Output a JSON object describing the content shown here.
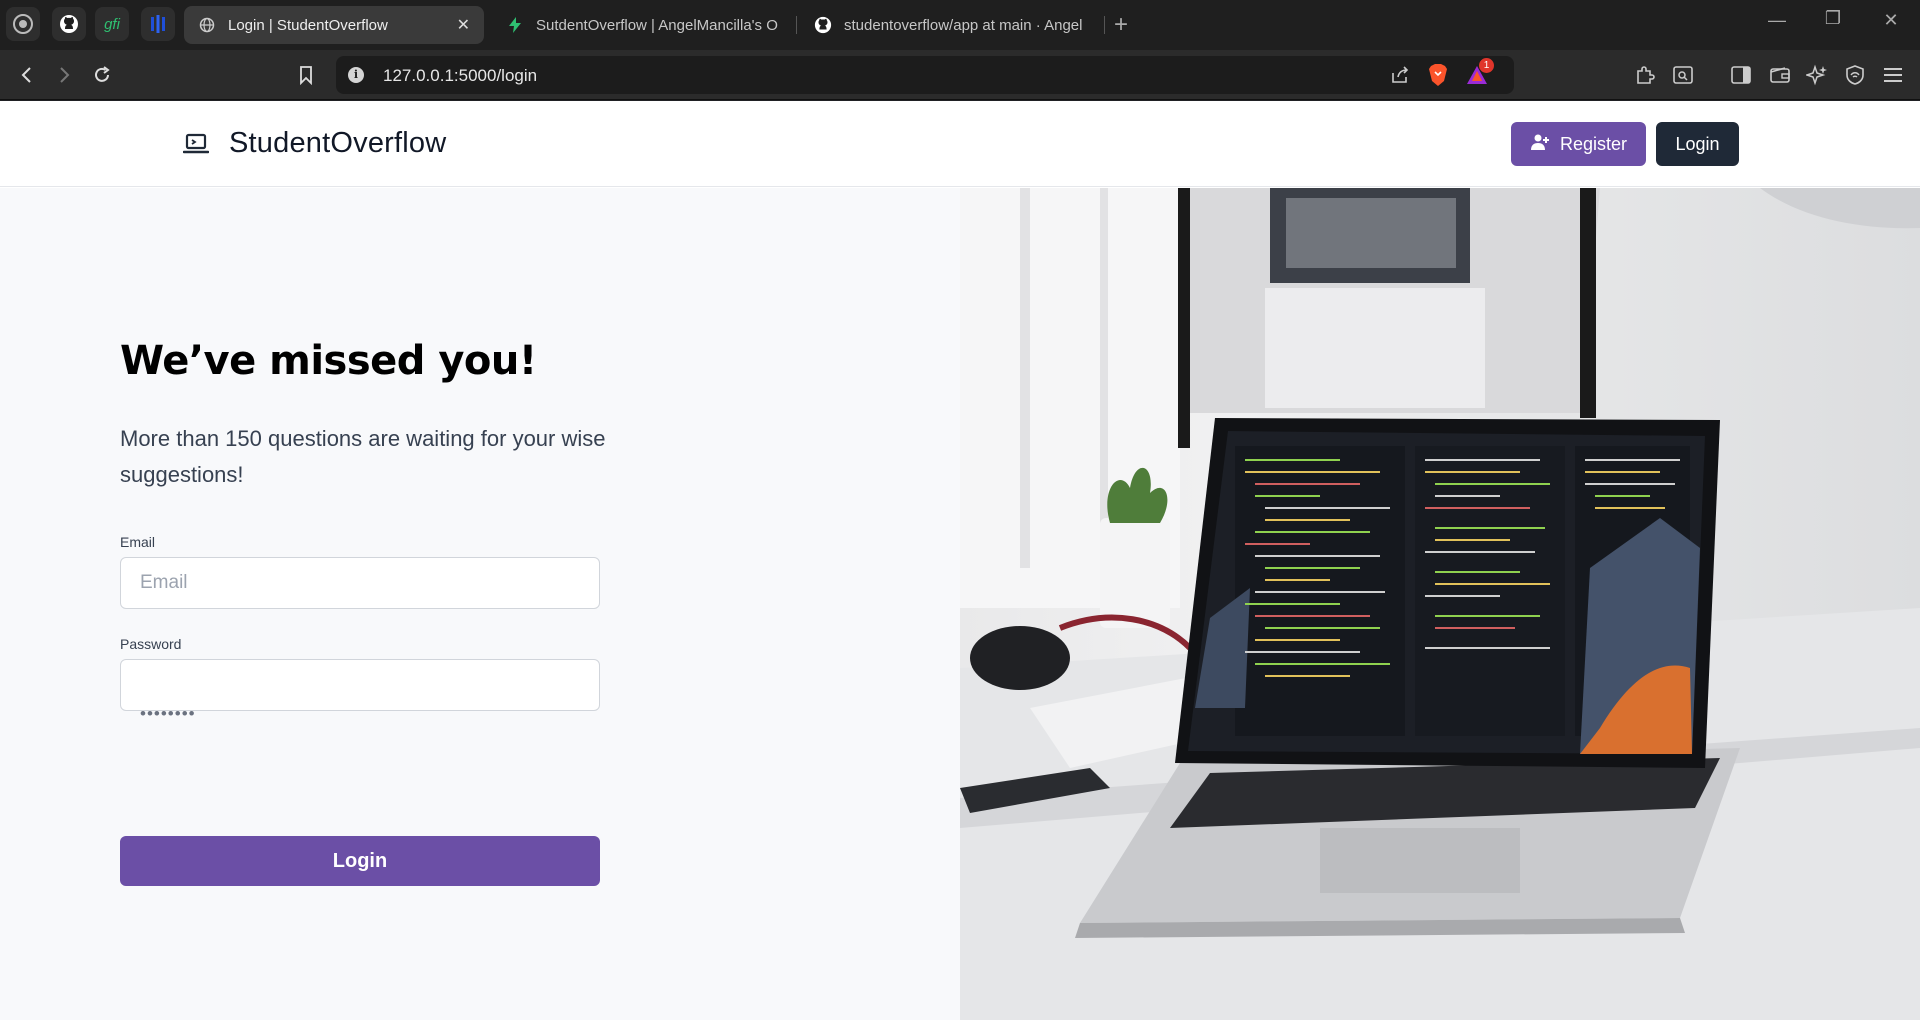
{
  "browser": {
    "pinned_tabs": [
      {
        "icon": "brave-rewards-icon"
      },
      {
        "icon": "github-icon"
      },
      {
        "icon": "gfi-icon",
        "label": "gfi"
      },
      {
        "icon": "app-icon"
      }
    ],
    "tabs": [
      {
        "title": "Login | StudentOverflow",
        "icon": "globe-icon",
        "active": true
      },
      {
        "title": "SutdentOverflow | AngelMancilla's O",
        "icon": "bolt-icon",
        "active": false
      },
      {
        "title": "studentoverflow/app at main · Angel",
        "icon": "github-icon",
        "active": false
      }
    ],
    "url": "127.0.0.1:5000/login",
    "notification_count": "1"
  },
  "site": {
    "brand": "StudentOverflow",
    "register_label": "Register",
    "login_label": "Login"
  },
  "login": {
    "headline": "We’ve missed you!",
    "subtitle": "More than 150 questions are waiting for your wise suggestions!",
    "email_label": "Email",
    "email_placeholder": "Email",
    "password_label": "Password",
    "password_value": "••••••••",
    "submit_label": "Login"
  },
  "colors": {
    "primary": "#6b4fa6",
    "dark": "#1f2937",
    "panel": "#f8f9fb"
  }
}
